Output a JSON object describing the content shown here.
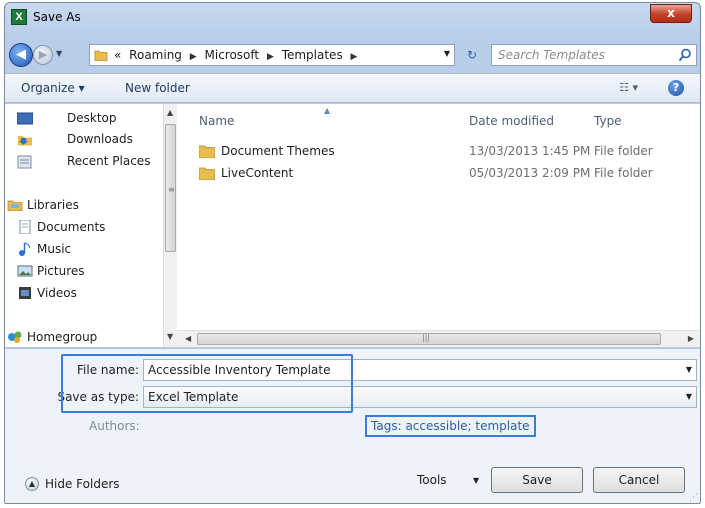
{
  "window": {
    "title": "Save As",
    "app_icon": "X",
    "close": "x"
  },
  "address": {
    "crumb_lead": "«",
    "crumbs": [
      "Roaming",
      "Microsoft",
      "Templates"
    ],
    "search_placeholder": "Search Templates"
  },
  "toolbar": {
    "organize": "Organize ▾",
    "new_folder": "New folder",
    "help": "?"
  },
  "nav": {
    "items": [
      "Desktop",
      "Downloads",
      "Recent Places",
      "Libraries",
      "Documents",
      "Music",
      "Pictures",
      "Videos",
      "Homegroup"
    ]
  },
  "columns": {
    "name": "Name",
    "date": "Date modified",
    "type": "Type"
  },
  "files": [
    {
      "name": "Document Themes",
      "date": "13/03/2013 1:45 PM",
      "type": "File folder"
    },
    {
      "name": "LiveContent",
      "date": "05/03/2013 2:09 PM",
      "type": "File folder"
    }
  ],
  "form": {
    "file_name_label": "File name:",
    "file_name_value": "Accessible Inventory Template",
    "save_type_label": "Save as type:",
    "save_type_value": "Excel Template",
    "authors_label": "Authors:",
    "tags_label": "Tags:",
    "tags_value": "accessible; template"
  },
  "footer": {
    "hide_folders": "Hide Folders",
    "tools": "Tools",
    "save": "Save",
    "cancel": "Cancel"
  },
  "colors": {
    "highlight": "#3a7fd6",
    "chrome": "#b8cde9",
    "link": "#2a5ea8"
  }
}
